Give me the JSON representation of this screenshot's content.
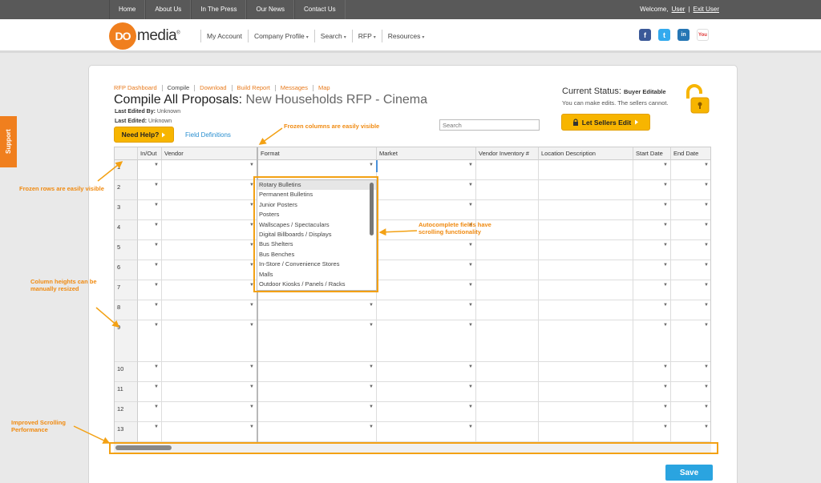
{
  "topnav": {
    "items": [
      "Home",
      "About Us",
      "In The Press",
      "Our News",
      "Contact Us"
    ],
    "welcome_label": "Welcome,",
    "user_link": "User",
    "separator": "|",
    "exit_link": "Exit User"
  },
  "header": {
    "logo_do": "DO",
    "logo_media": "media",
    "logo_reg": "®",
    "nav": [
      {
        "label": "My Account",
        "caret": ""
      },
      {
        "label": "Company Profile",
        "caret": "▾"
      },
      {
        "label": "Search",
        "caret": "▾"
      },
      {
        "label": "RFP",
        "caret": "▾"
      },
      {
        "label": "Resources",
        "caret": "▾"
      }
    ],
    "social": [
      "f",
      "t",
      "in",
      "You"
    ]
  },
  "support_label": "Support",
  "breadcrumbs": [
    "RFP Dashboard",
    "Compile",
    "Download",
    "Build Report",
    "Messages",
    "Map"
  ],
  "title": {
    "lead": "Compile All Proposals:",
    "name": "New Households RFP - Cinema"
  },
  "meta": {
    "last_edited_by_label": "Last Edited By:",
    "last_edited_by": "Unknown",
    "last_edited_label": "Last Edited:",
    "last_edited": "Unknown"
  },
  "buttons": {
    "need_help": "Need Help?",
    "field_definitions": "Field Definitions",
    "let_sellers_edit": "Let Sellers Edit",
    "save": "Save"
  },
  "search": {
    "placeholder": "Search"
  },
  "status": {
    "label": "Current Status:",
    "value": "Buyer Editable",
    "sub": "You can make edits. The sellers cannot."
  },
  "grid": {
    "columns": [
      "In/Out",
      "Vendor",
      "Format",
      "Market",
      "Vendor Inventory #",
      "Location Description",
      "Start Date",
      "End Date"
    ],
    "rows": [
      "1",
      "2",
      "3",
      "4",
      "5",
      "6",
      "7",
      "8",
      "9",
      "10",
      "11",
      "12",
      "13"
    ],
    "dropdown_options": [
      "Rotary Bulletins",
      "Permanent Bulletins",
      "Junior Posters",
      "Posters",
      "Wallscapes / Spectaculars",
      "Digital Billboards / Displays",
      "Bus Shelters",
      "Bus Benches",
      "In-Store / Convenience Stores",
      "Malls",
      "Outdoor Kiosks / Panels / Racks"
    ],
    "selected_option": "Rotary Bulletins"
  },
  "annotations": {
    "frozen_columns": "Frozen columns are easily visible",
    "frozen_rows": "Frozen rows are easily visible",
    "autocomplete": "Autocomplete fields have scrolling functionality",
    "column_heights": "Column heights can be manually resized",
    "scrolling": "Improved Scrolling Performance"
  },
  "colors": {
    "accent": "#f07f1e",
    "button": "#f7b500",
    "save": "#2aa4e0",
    "annotation": "#f08a10"
  }
}
